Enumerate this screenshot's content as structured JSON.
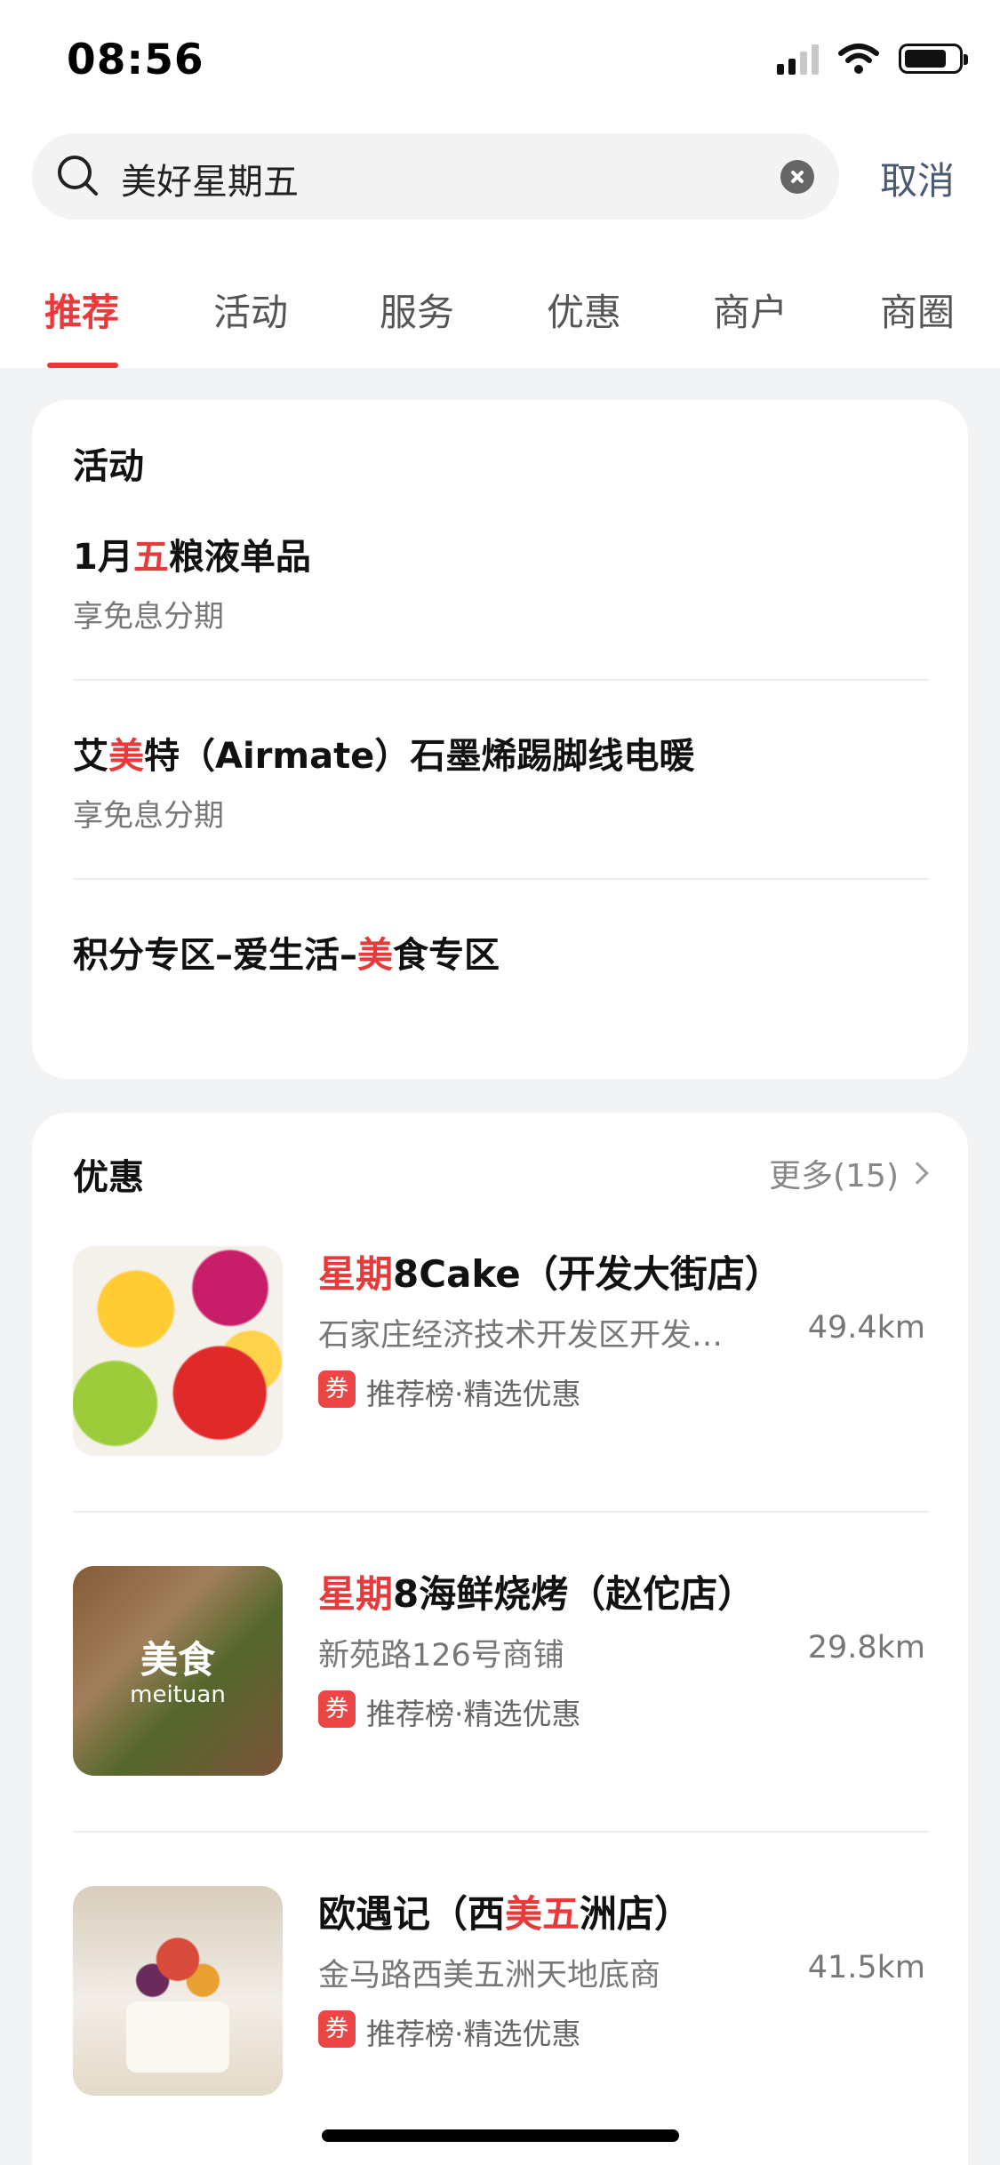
{
  "status_bar": {
    "time": "08:56"
  },
  "search": {
    "query": "美好星期五",
    "cancel_label": "取消"
  },
  "tabs": [
    {
      "label": "推荐",
      "active": true
    },
    {
      "label": "活动"
    },
    {
      "label": "服务"
    },
    {
      "label": "优惠"
    },
    {
      "label": "商户"
    },
    {
      "label": "商圈"
    }
  ],
  "activity": {
    "title": "活动",
    "items": [
      {
        "pre": "1月",
        "hl": "五",
        "post": "粮液单品",
        "subtitle": "享免息分期"
      },
      {
        "pre": "艾",
        "hl": "美",
        "post": "特（Airmate）石墨烯踢脚线电暖",
        "subtitle": "享免息分期"
      },
      {
        "pre": "积分专区–爱生活–",
        "hl": "美",
        "post": "食专区"
      }
    ]
  },
  "deals": {
    "title": "优惠",
    "more_label": "更多(15)",
    "items": [
      {
        "name_hl": "星期",
        "name_rest": "8Cake（开发大街店）",
        "address": "石家庄经济技术开发区开发…",
        "distance": "49.4km",
        "coupon": "券",
        "tags": "推荐榜·精选优惠"
      },
      {
        "name_hl": "星期",
        "name_rest": "8海鲜烧烤（赵佗店）",
        "address": "新苑路126号商铺",
        "distance": "29.8km",
        "coupon": "券",
        "tags": "推荐榜·精选优惠",
        "thumb_title": "美食",
        "thumb_sub": "meituan"
      },
      {
        "name_pre": "欧遇记（西",
        "name_hl": "美五",
        "name_rest": "洲店）",
        "address": "金马路西美五洲天地底商",
        "distance": "41.5km",
        "coupon": "券",
        "tags": "推荐榜·精选优惠"
      }
    ]
  },
  "colors": {
    "accent": "#e83a3a",
    "cancel": "#4a5a73",
    "background": "#f2f3f5"
  },
  "icons": [
    "signal-icon",
    "wifi-icon",
    "battery-icon",
    "search-icon",
    "clear-icon",
    "chevron-right-icon",
    "coupon-icon"
  ]
}
